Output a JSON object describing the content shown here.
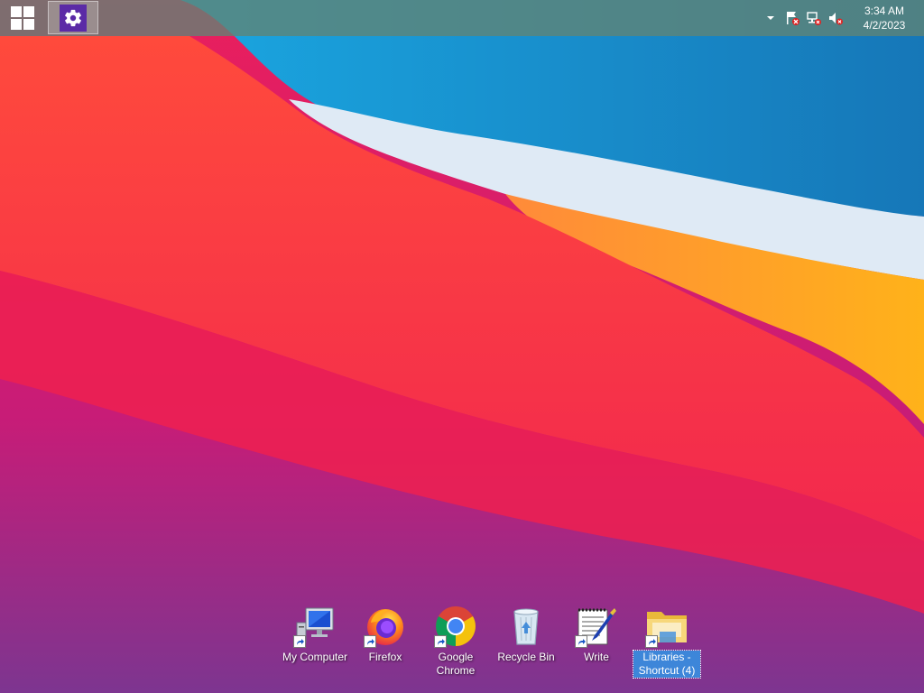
{
  "taskbar": {
    "pinned": [
      {
        "name": "settings-icon"
      }
    ],
    "tray": {
      "icons": [
        "tray-chevron-up-icon",
        "action-center-flag-icon",
        "network-icon",
        "volume-muted-icon"
      ],
      "time": "3:34 AM",
      "date": "4/2/2023"
    }
  },
  "desktop": {
    "icons": [
      {
        "label": "My Computer",
        "icon": "computer-icon",
        "selected": false
      },
      {
        "label": "Firefox",
        "icon": "firefox-icon",
        "selected": false
      },
      {
        "label": "Google Chrome",
        "icon": "chrome-icon",
        "selected": false
      },
      {
        "label": "Recycle Bin",
        "icon": "recycle-bin-icon",
        "selected": false
      },
      {
        "label": "Write",
        "icon": "write-icon",
        "selected": false
      },
      {
        "label": "Libraries - Shortcut (4)",
        "icon": "libraries-folder-icon",
        "selected": true
      }
    ]
  },
  "colors": {
    "taskbar": "#608474",
    "settings_tile": "#5b2aa6",
    "selection": "#3d86d9"
  }
}
